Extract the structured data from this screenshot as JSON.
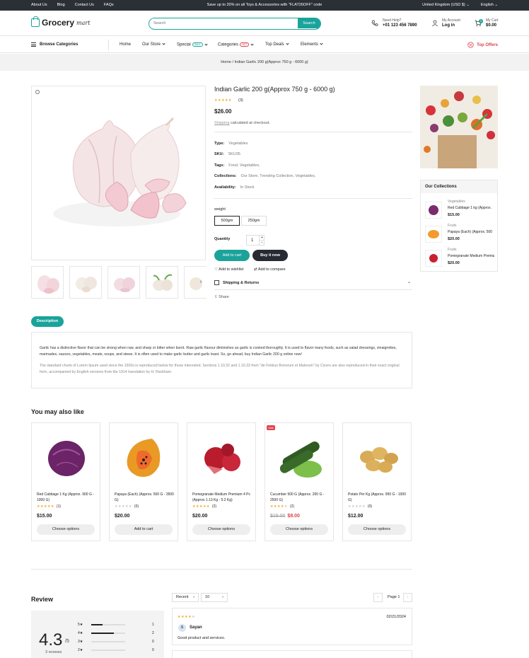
{
  "topbar": {
    "links": [
      "About Us",
      "Blog",
      "Contact Us",
      "FAQs"
    ],
    "promo": "Save up to 20% on all Toys & Accessories with \"FLAT26OFF\" code",
    "region": "United Kingdom (USD $)",
    "language": "English"
  },
  "header": {
    "logo_main": "Grocery",
    "logo_script": "mart",
    "search_placeholder": "Search",
    "search_button": "Search",
    "help_label": "Need Help?",
    "help_phone": "+01 123 456 7890",
    "account_label": "My Account",
    "account_action": "Log in",
    "cart_label": "My Cart",
    "cart_total": "$0.00",
    "cart_count": "0"
  },
  "nav": {
    "browse": "Browse Categories",
    "items": [
      "Home",
      "Our Store",
      "Special",
      "Categories",
      "Top Deals",
      "Elements"
    ],
    "special_tag": "SALE",
    "categories_tag": "HOT",
    "offers": "Top Offers"
  },
  "breadcrumb": {
    "home": "Home",
    "sep": "/",
    "current": "Indian Garlic 200 g(Approx 750 g - 6000 g)"
  },
  "product": {
    "title": "Indian Garlic 200 g(Approx 750 g - 6000 g)",
    "rating": 5,
    "review_count": "(3)",
    "price": "$26.00",
    "shipping_link": "Shipping",
    "shipping_note": "calculated at checkout.",
    "type_label": "Type:",
    "type_value": "Vegetables",
    "sku_label": "SKU:",
    "sku_value": "SKU35",
    "tags_label": "Tags:",
    "tags_value": "Food, Vegetables,",
    "collections_label": "Collections:",
    "collections_value": "Our Store, Trending Collection, Vegetables,",
    "availability_label": "Availability:",
    "availability_value": "In Stock",
    "weight_label": "weight",
    "weights": [
      "500gm",
      "250gm"
    ],
    "quantity_label": "Quantity",
    "quantity": "1",
    "add_to_cart": "Add to cart",
    "buy_now": "Buy it now",
    "wishlist": "Add to wishlist",
    "compare": "Add to compare",
    "shipping_returns": "Shipping & Returns",
    "share": "Share"
  },
  "collections": {
    "title": "Our Collections",
    "items": [
      {
        "category": "Vegetables",
        "name": "Red Cabbage 1 kg (Approx.",
        "price": "$15.00"
      },
      {
        "category": "Fruits",
        "name": "Papaya (Each) (Approx. 500",
        "price": "$20.00"
      },
      {
        "category": "Fruits",
        "name": "Pomegranate Medium Premium",
        "price": "$20.00"
      }
    ]
  },
  "description": {
    "tab": "Description",
    "p1": "Garlic has a distinctive flavor that can be strong when raw, and sharp or bitter when burnt. Raw garlic flavour diminishes as garlic is cooked thoroughly. It is used to flavor many foods, such as salad dressings, vinaigrettes, marinades, sauces, vegetables, meats, soups, and stews. It is often used to make garlic butter and garlic toast. So, go ahead, buy Indian Garlic 200 g online now!",
    "p2": "The standard chunk of Lorem Ipsum used since the 1500s is reproduced below for those interested. Sections 1.10.32 and 1.10.33 from \"de Finibus Bonorum et Malorum\" by Cicero are also reproduced in their exact original form, accompanied by English versions from the 1914 translation by H. Rackham."
  },
  "related": {
    "title": "You may also like",
    "items": [
      {
        "name": "Red Cabbage 1 Kg (Approx. 900 G - 1000 G)",
        "rating": 5,
        "count": "(1)",
        "price": "$15.00",
        "old": "",
        "button": "Choose options",
        "sale": ""
      },
      {
        "name": "Papaya (Each) (Approx. 500 G - 3500 G)",
        "rating": 0,
        "count": "(0)",
        "price": "$20.00",
        "old": "",
        "button": "Add to cart",
        "sale": ""
      },
      {
        "name": "Pomegranate Medium Premium 4 Pc (Approx 1.13 Kg - 5.2 Kg)",
        "rating": 5,
        "count": "(2)",
        "price": "$20.00",
        "old": "",
        "button": "Choose options",
        "sale": ""
      },
      {
        "name": "Cucumber 500 G (Approx. 200 G - 2500 G)",
        "rating": 4,
        "count": "(2)",
        "price": "$8.00",
        "old": "$15.00",
        "button": "Choose options",
        "sale": "Sale"
      },
      {
        "name": "Potato Per Kg (Approx. 950 G - 1000 G)",
        "rating": 0,
        "count": "(0)",
        "price": "$12.00",
        "old": "",
        "button": "Choose options",
        "sale": ""
      }
    ]
  },
  "reviews": {
    "title": "Review",
    "average": "4.3",
    "out_of": "5",
    "count_text": "3 reviews",
    "distribution": [
      {
        "stars": "5★",
        "count": "1",
        "fraction": 0.33
      },
      {
        "stars": "4★",
        "count": "2",
        "fraction": 0.67
      },
      {
        "stars": "3★",
        "count": "0",
        "fraction": 0
      },
      {
        "stars": "2★",
        "count": "0",
        "fraction": 0
      }
    ],
    "sort": "Recent",
    "per_page": "10",
    "page_label": "Page 1",
    "items": [
      {
        "rating": 4,
        "date": "02/21/2024",
        "initial": "S",
        "author": "Sayan",
        "text": "Good product and services."
      }
    ]
  }
}
